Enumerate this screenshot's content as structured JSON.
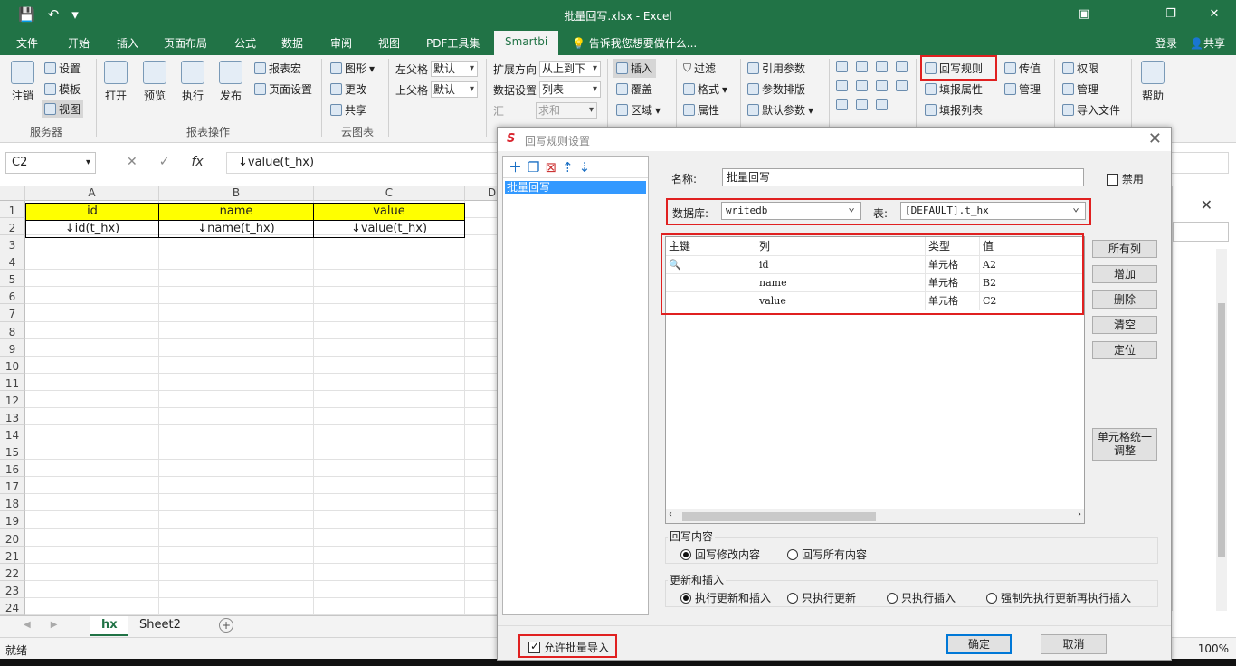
{
  "window": {
    "title": "批量回写.xlsx - Excel",
    "min": "—",
    "restore": "❐",
    "close": "✕",
    "ribbon_opts": "▣",
    "qat": [
      "💾",
      "↶",
      "▾"
    ]
  },
  "tabs": [
    "文件",
    "开始",
    "插入",
    "页面布局",
    "公式",
    "数据",
    "审阅",
    "视图",
    "PDF工具集",
    "Smartbi"
  ],
  "tell_me": "告诉我您想要做什么...",
  "account": {
    "login": "登录",
    "share": "共享"
  },
  "ribbon": {
    "server": {
      "logout": "注销",
      "settings": "设置",
      "template": "模板",
      "view": "视图",
      "group": "服务器"
    },
    "report_ops": {
      "open": "打开",
      "preview": "预览",
      "run": "执行",
      "publish": "发布",
      "report_macro": "报表宏",
      "page_setup": "页面设置",
      "group": "报表操作"
    },
    "cloud": {
      "chart": "图形",
      "change": "更改",
      "share": "共享",
      "group": "云图表"
    },
    "parent": {
      "left_label": "左父格",
      "left_value": "默认",
      "top_label": "上父格",
      "top_value": "默认"
    },
    "expand": {
      "dir_label": "扩展方向",
      "dir_value": "从上到下",
      "data_label": "数据设置",
      "data_value": "列表",
      "agg_label": "汇",
      "agg_value": "求和"
    },
    "insert": {
      "insert": "插入",
      "cover": "覆盖",
      "region": "区域"
    },
    "filter": {
      "filter": "过滤",
      "format": "格式",
      "props": "属性"
    },
    "params": {
      "ref": "引用参数",
      "layout": "参数排版",
      "default": "默认参数"
    },
    "writeback": {
      "rule": "回写规则",
      "fill_props": "填报属性",
      "fill_list": "填报列表"
    },
    "transfer": {
      "pass": "传值",
      "manage": "管理"
    },
    "perm": {
      "perm": "权限",
      "manage": "管理",
      "import": "导入文件"
    },
    "help": "帮助"
  },
  "formula": {
    "cell_ref": "C2",
    "fx": "fx",
    "cancel": "✕",
    "enter": "✓",
    "content": "↓value(t_hx)"
  },
  "sheet": {
    "columns": [
      "A",
      "B",
      "C",
      "D"
    ],
    "rows": [
      "1",
      "2",
      "3",
      "4",
      "5",
      "6",
      "7",
      "8",
      "9",
      "10",
      "11",
      "12",
      "13",
      "14",
      "15",
      "16",
      "17",
      "18",
      "19",
      "20",
      "21",
      "22",
      "23",
      "24"
    ],
    "header_row": [
      "id",
      "name",
      "value"
    ],
    "binding_row": [
      "↓id(t_hx)",
      "↓name(t_hx)",
      "↓value(t_hx)"
    ],
    "tabs": [
      "hx",
      "Sheet2"
    ]
  },
  "status": {
    "ready": "就绪",
    "zoom": "100%"
  },
  "dialog": {
    "title": "回写规则设置",
    "logo": "S",
    "rules": [
      "批量回写"
    ],
    "name_label": "名称:",
    "name_value": "批量回写",
    "disable_label": "禁用",
    "db_label": "数据库:",
    "db_value": "writedb",
    "table_label": "表:",
    "table_value": "[DEFAULT].t_hx",
    "columns": [
      "主键",
      "列",
      "类型",
      "值"
    ],
    "rows": [
      {
        "key": "🔍",
        "col": "id",
        "type": "单元格",
        "val": "A2"
      },
      {
        "key": "",
        "col": "name",
        "type": "单元格",
        "val": "B2"
      },
      {
        "key": "",
        "col": "value",
        "type": "单元格",
        "val": "C2"
      }
    ],
    "buttons": [
      "所有列",
      "增加",
      "删除",
      "清空",
      "定位"
    ],
    "unify_btn_l1": "单元格统一",
    "unify_btn_l2": "调整",
    "content_legend": "回写内容",
    "content_opts": [
      "回写修改内容",
      "回写所有内容"
    ],
    "update_legend": "更新和插入",
    "update_opts": [
      "执行更新和插入",
      "只执行更新",
      "只执行插入",
      "强制先执行更新再执行插入"
    ],
    "batch_import": "允许批量导入",
    "ok": "确定",
    "cancel": "取消"
  },
  "colors": {
    "excel_green": "#217346",
    "highlight_red": "#e02020",
    "header_yellow": "#ffff00",
    "selection_blue": "#3399ff"
  }
}
